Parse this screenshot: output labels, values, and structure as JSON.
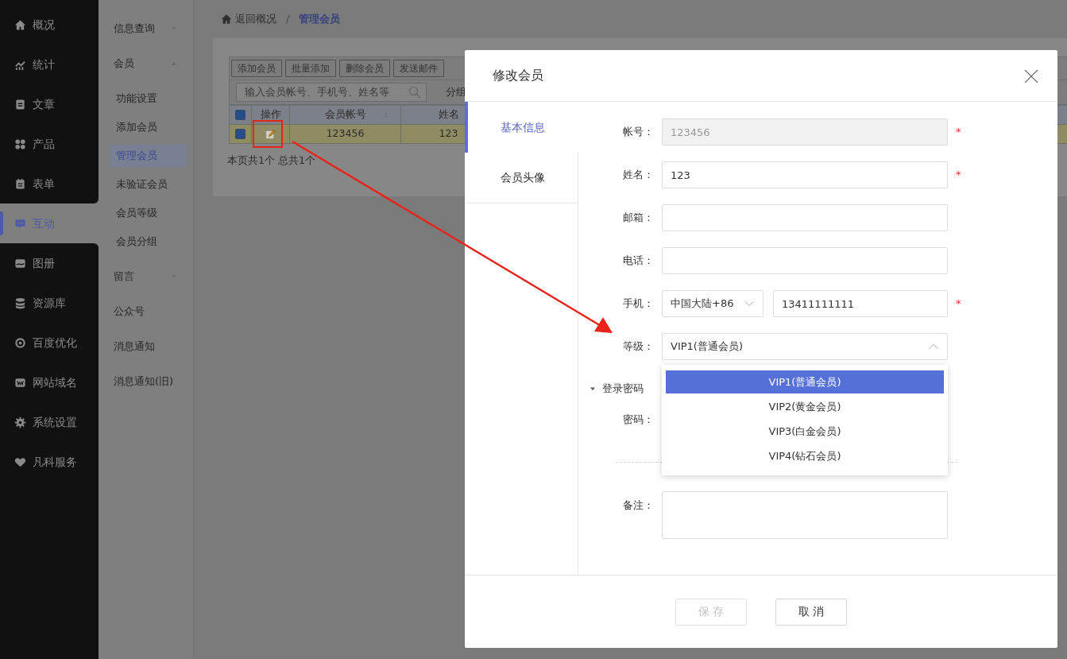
{
  "nav": {
    "items": [
      {
        "label": "概况",
        "selected": false
      },
      {
        "label": "统计",
        "selected": false
      },
      {
        "label": "文章",
        "selected": false
      },
      {
        "label": "产品",
        "selected": false
      },
      {
        "label": "表单",
        "selected": false
      },
      {
        "label": "互动",
        "selected": true
      },
      {
        "label": "图册",
        "selected": false
      },
      {
        "label": "资源库",
        "selected": false
      },
      {
        "label": "百度优化",
        "selected": false
      },
      {
        "label": "网站域名",
        "selected": false
      },
      {
        "label": "系统设置",
        "selected": false
      },
      {
        "label": "凡科服务",
        "selected": false
      }
    ]
  },
  "subnav": {
    "items": [
      {
        "kind": "group",
        "label": "信息查询",
        "expanded": false
      },
      {
        "kind": "group",
        "label": "会员",
        "expanded": true
      },
      {
        "kind": "item",
        "label": "功能设置",
        "selected": false
      },
      {
        "kind": "item",
        "label": "添加会员",
        "selected": false
      },
      {
        "kind": "item",
        "label": "管理会员",
        "selected": true
      },
      {
        "kind": "item",
        "label": "未验证会员",
        "selected": false
      },
      {
        "kind": "item",
        "label": "会员等级",
        "selected": false
      },
      {
        "kind": "item",
        "label": "会员分组",
        "selected": false
      },
      {
        "kind": "group",
        "label": "留言",
        "expanded": false
      },
      {
        "kind": "link",
        "label": "公众号"
      },
      {
        "kind": "link",
        "label": "消息通知"
      },
      {
        "kind": "link",
        "label": "消息通知(旧)"
      }
    ]
  },
  "breadcrumb": {
    "back": "返回概况",
    "separator": "/",
    "current": "管理会员"
  },
  "toolbar": {
    "buttons": [
      "添加会员",
      "批量添加",
      "删除会员",
      "发送邮件"
    ],
    "search": {
      "placeholder": "输入会员帐号、手机号、姓名等"
    },
    "group_label": "分组"
  },
  "table": {
    "all_checked": true,
    "columns": [
      {
        "label": "操作"
      },
      {
        "label": "会员帐号",
        "sortable": true
      },
      {
        "label": "姓名"
      }
    ],
    "rows": [
      {
        "checked": true,
        "highlighted": true,
        "account": "123456",
        "name": "123"
      }
    ]
  },
  "summary": "本页共1个 总共1个",
  "modal": {
    "title": "修改会员",
    "required_mark": "*",
    "tabs": [
      {
        "label": "基本信息",
        "selected": true
      },
      {
        "label": "会员头像",
        "selected": false
      }
    ],
    "fields": [
      {
        "kind": "text",
        "label": "帐号：",
        "value": "123456",
        "disabled": true,
        "required": true
      },
      {
        "kind": "text",
        "label": "姓名：",
        "value": "123",
        "disabled": false,
        "required": true
      },
      {
        "kind": "text",
        "label": "邮箱：",
        "disabled": false,
        "required": false
      },
      {
        "kind": "text",
        "label": "电话：",
        "disabled": false,
        "required": false
      },
      {
        "kind": "phone",
        "label": "手机：",
        "region": "中国大陆+86",
        "value": "13411111111",
        "required": true
      },
      {
        "kind": "select",
        "label": "等级：",
        "value": "VIP1(普通会员)",
        "expanded": true,
        "options": [
          {
            "label": "VIP1(普通会员)",
            "selected": true
          },
          {
            "label": "VIP2(黄金会员)",
            "selected": false
          },
          {
            "label": "VIP3(白金会员)",
            "selected": false
          },
          {
            "label": "VIP4(钻石会员)",
            "selected": false
          }
        ]
      }
    ],
    "password_section": {
      "label": "登录密码",
      "expanded": true,
      "field_label": "密码："
    },
    "remark": {
      "label": "备注："
    },
    "buttons": [
      {
        "label": "保 存",
        "disabled": true
      },
      {
        "label": "取 消",
        "disabled": false
      }
    ]
  }
}
